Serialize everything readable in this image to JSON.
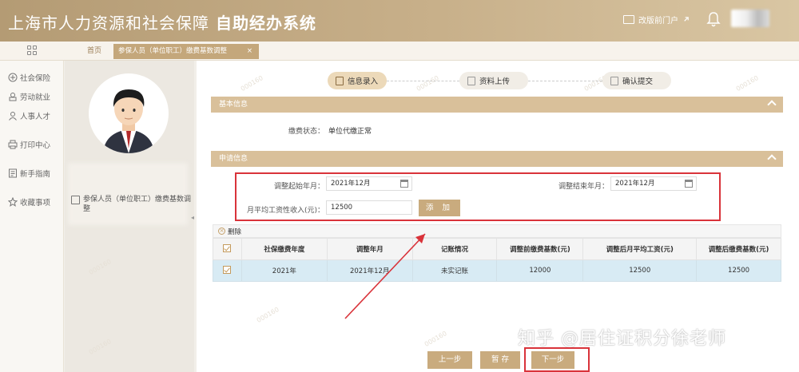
{
  "header": {
    "title_main": "上海市人力资源和社会保障",
    "title_bold": "自助经办系统",
    "portal_link": "改版前门户"
  },
  "tabs": {
    "home": "首页",
    "active": "参保人员（单位职工）缴费基数调整",
    "close": "×"
  },
  "nav": {
    "items": [
      {
        "label": "社会保险",
        "icon": "social-insurance-icon"
      },
      {
        "label": "劳动就业",
        "icon": "employment-icon"
      },
      {
        "label": "人事人才",
        "icon": "person-icon"
      },
      {
        "label": "打印中心",
        "icon": "printer-icon"
      },
      {
        "label": "新手指南",
        "icon": "guide-icon"
      },
      {
        "label": "收藏事项",
        "icon": "star-icon"
      }
    ]
  },
  "profile": {
    "service_item": "参保人员（单位职工）缴费基数调整"
  },
  "steps": [
    {
      "label": "信息录入"
    },
    {
      "label": "资料上传"
    },
    {
      "label": "确认提交"
    }
  ],
  "basic_info": {
    "title": "基本信息",
    "status_label": "缴费状态：",
    "status_value": "单位代缴正常"
  },
  "application": {
    "title": "申请信息",
    "start_label": "调整起始年月：",
    "start_value": "2021年12月",
    "end_label": "调整结束年月：",
    "end_value": "2021年12月",
    "income_label": "月平均工资性收入(元)：",
    "income_value": "12500",
    "add_button": "添 加"
  },
  "table": {
    "delete_label": "删除",
    "columns": [
      "社保缴费年度",
      "调整年月",
      "记账情况",
      "调整前缴费基数(元)",
      "调整后月平均工资(元)",
      "调整后缴费基数(元)"
    ],
    "rows": [
      [
        "2021年",
        "2021年12月",
        "未实记账",
        "12000",
        "12500",
        "12500"
      ]
    ]
  },
  "buttons": {
    "prev": "上一步",
    "save": "暂 存",
    "next": "下一步"
  },
  "overlay": {
    "zhihu_watermark": "知乎 @居住证积分徐老师"
  },
  "colors": {
    "header_gold": "#b49b74",
    "accent_gold": "#c9ab7e",
    "highlight_red": "#d9333a",
    "row_selected": "#d8ebf4"
  }
}
